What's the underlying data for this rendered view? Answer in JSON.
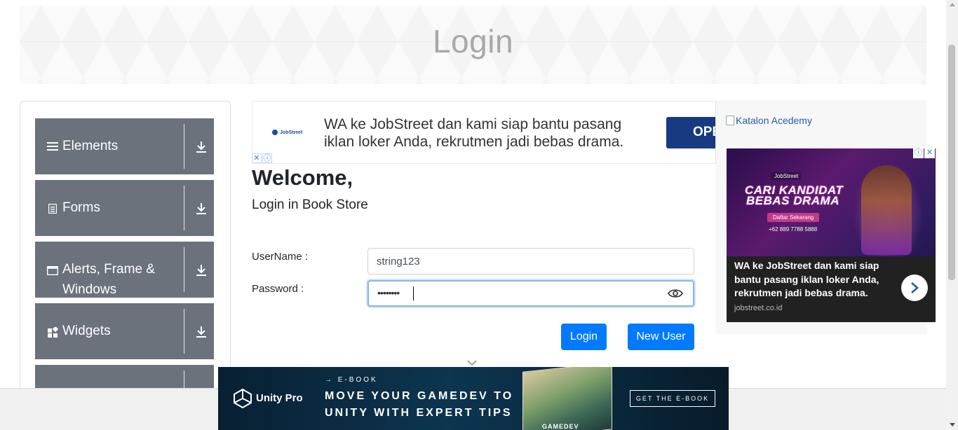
{
  "header": {
    "title": "Login"
  },
  "sidebar": {
    "groups": [
      {
        "label": "Elements",
        "icon": "menu-icon"
      },
      {
        "label": "Forms",
        "icon": "document-icon"
      },
      {
        "label": "Alerts, Frame &",
        "label2": "Windows",
        "icon": "window-icon"
      },
      {
        "label": "Widgets",
        "icon": "widgets-icon"
      },
      {
        "label": "",
        "icon": ""
      }
    ]
  },
  "top_ad": {
    "brand": "JobStreet",
    "text": "WA ke JobStreet dan kami siap bantu pasang iklan loker Anda, rekrutmen jadi bebas drama.",
    "cta": "OPE",
    "close": "✕",
    "info": "ⓘ"
  },
  "form": {
    "welcome": "Welcome,",
    "subtitle": "Login in Book Store",
    "username_label": "UserName :",
    "username_value": "string123",
    "password_label": "Password :",
    "password_mask": "••••••••",
    "login_button": "Login",
    "new_user_button": "New User"
  },
  "right_ad": {
    "alt_text": "Katalon Acedemy",
    "brand": "JobStreet",
    "headline_1": "CARI KANDIDAT",
    "headline_2": "BEBAS DRAMA",
    "cta": "Daftar Sekarang",
    "phone": "+62 889 7788 5888",
    "body": "WA ke JobStreet dan kami siap bantu pasang iklan loker Anda, rekrutmen jadi bebas drama.",
    "domain": "jobstreet.co.id",
    "close": "✕",
    "info": "ⓘ"
  },
  "bottom_ad": {
    "brand": "Unity Pro",
    "tag": "→ E-BOOK",
    "headline_1": "MOVE YOUR GAMEDEV TO",
    "headline_2": "UNITY WITH EXPERT TIPS",
    "book_text": "GAMEDEV",
    "cta": "GET THE E-BOOK"
  },
  "colors": {
    "primary": "#007bff",
    "sidebar_header": "#6b727b",
    "title": "#a8a8a8"
  }
}
